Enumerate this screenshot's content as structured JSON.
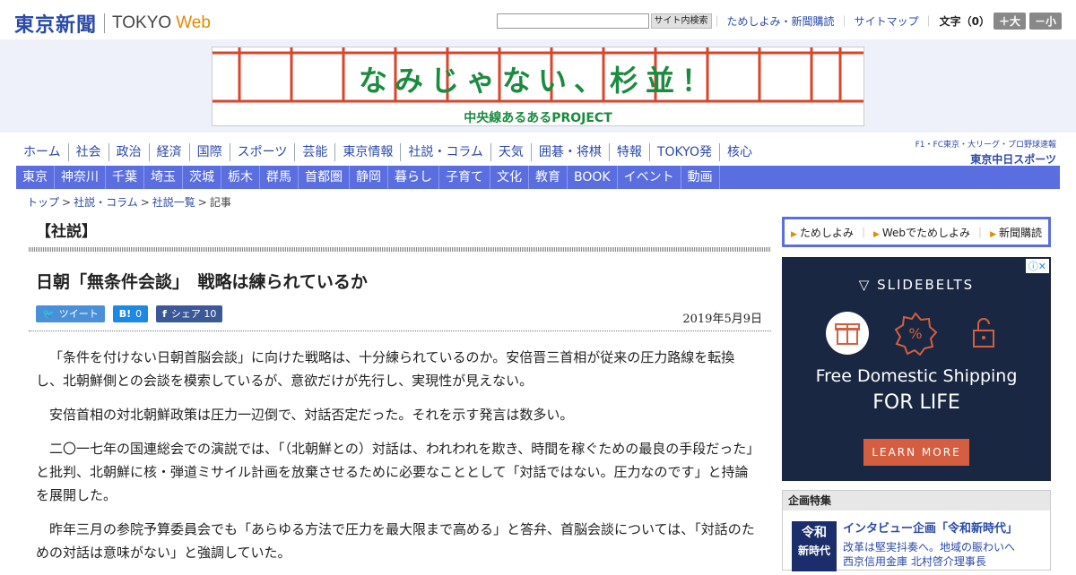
{
  "header": {
    "logo_jp": "東京新聞",
    "logo_en": "TOKYO",
    "logo_web": "Web",
    "search_button": "サイト内検索",
    "links": [
      "ためしよみ・新聞購読",
      "サイトマップ"
    ],
    "font_size_label": "文字（0）",
    "font_larger": "＋大",
    "font_smaller": "－小"
  },
  "banner": {
    "title": "なみじゃない、杉並！",
    "subtitle": "中央線あるあるPROJECT"
  },
  "nav_main": [
    "ホーム",
    "社会",
    "政治",
    "経済",
    "国際",
    "スポーツ",
    "芸能",
    "東京情報",
    "社説・コラム",
    "天気",
    "囲碁・将棋",
    "特報",
    "TOKYO発",
    "核心"
  ],
  "chunichi": {
    "top": "F1・FC東京・大リーグ・プロ野球速報",
    "logo": "東京中日スポーツ"
  },
  "nav_sub": [
    "東京",
    "神奈川",
    "千葉",
    "埼玉",
    "茨城",
    "栃木",
    "群馬",
    "首都圏",
    "静岡",
    "暮らし",
    "子育て",
    "文化",
    "教育",
    "BOOK",
    "イベント",
    "動画"
  ],
  "breadcrumb": [
    "トップ",
    "社説・コラム",
    "社説一覧",
    "記事"
  ],
  "article": {
    "section": "【社説】",
    "title": "日朝「無条件会談」　戦略は練られているか",
    "share": {
      "tweet": "ツイート",
      "hatena_icon": "B!",
      "hatena_count": "0",
      "fb_icon": "f",
      "fb_label": "シェア",
      "fb_count": "10"
    },
    "date": "2019年5月9日",
    "paragraphs": [
      "「条件を付けない日朝首脳会談」に向けた戦略は、十分練られているのか。安倍晋三首相が従来の圧力路線を転換し、北朝鮮側との会談を模索しているが、意欲だけが先行し、実現性が見えない。",
      "安倍首相の対北朝鮮政策は圧力一辺倒で、対話否定だった。それを示す発言は数多い。",
      "二〇一七年の国連総会での演説では、「（北朝鮮との）対話は、われわれを欺き、時間を稼ぐための最良の手段だった」と批判、北朝鮮に核・弾道ミサイル計画を放棄させるために必要なこととして「対話ではない。圧力なのです」と持論を展開した。",
      "昨年三月の参院予算委員会でも「あらゆる方法で圧力を最大限まで高める」と答弁、首脳会談については、「対話のための対話は意味がない」と強調していた。"
    ]
  },
  "sidebar": {
    "nav": [
      "ためしよみ",
      "Webでためしよみ",
      "新聞購読"
    ],
    "ad": {
      "badge": "ⓘ✕",
      "brand": "SLIDEBELTS",
      "line1": "Free Domestic Shipping",
      "line2": "FOR LIFE",
      "cta": "LEARN MORE"
    },
    "feature": {
      "header": "企画特集",
      "thumb_line1": "令和",
      "thumb_line2": "新時代",
      "title": "インタビュー企画「令和新時代」",
      "line1": "改革は堅実抖奏へ。地域の賑わいへ",
      "line2": "西京信用金庫 北村啓介理事長"
    }
  }
}
